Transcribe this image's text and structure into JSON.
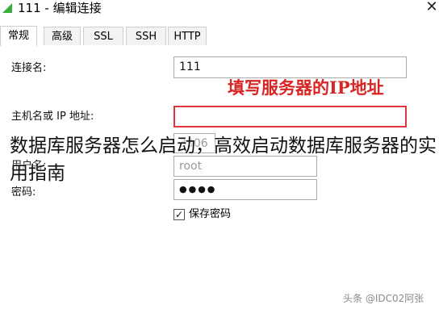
{
  "window": {
    "title": "111 - 编辑连接",
    "close_glyph": "✕",
    "accent_color": "#3cae3c"
  },
  "tabs": [
    {
      "label": "常规",
      "active": true
    },
    {
      "label": "高级",
      "active": false
    },
    {
      "label": "SSL",
      "active": false
    },
    {
      "label": "SSH",
      "active": false
    },
    {
      "label": "HTTP",
      "active": false
    }
  ],
  "form": {
    "connection_name_label": "连接名:",
    "connection_name_value": "111",
    "host_label": "主机名或 IP 地址:",
    "host_value": "",
    "port_value": "3306",
    "username_label": "用户名:",
    "username_value": "root",
    "password_label": "密码:",
    "password_value": "●●●●",
    "save_password_label": "保存密码",
    "save_password_checked": true
  },
  "annotation": {
    "text": "填写服务器的IP地址",
    "color": "#d92424"
  },
  "overlay": {
    "headline": "数据库服务器怎么启动，高效启动数据库服务器的实用指南"
  },
  "watermark": {
    "text": "头条 @IDC02阿张"
  }
}
